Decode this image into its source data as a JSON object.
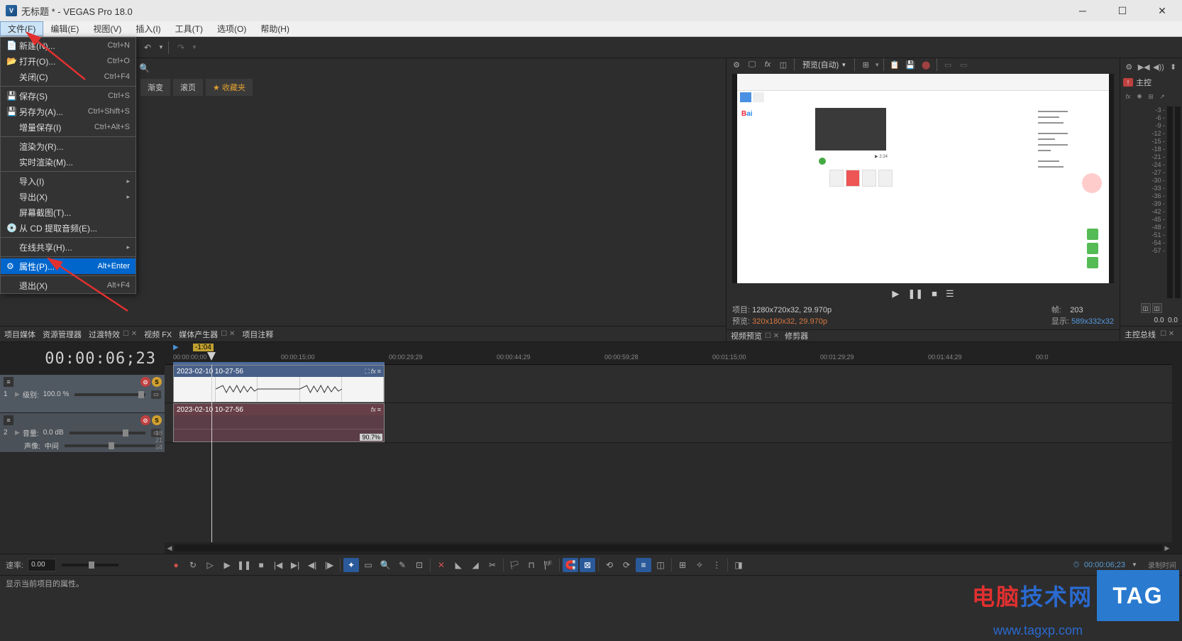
{
  "titlebar": {
    "title": "无标题 * - VEGAS Pro 18.0",
    "icon": "V"
  },
  "menubar": {
    "items": [
      "文件(F)",
      "编辑(E)",
      "视图(V)",
      "插入(I)",
      "工具(T)",
      "选项(O)",
      "帮助(H)"
    ]
  },
  "dropdown": {
    "items": [
      {
        "label": "新建(N)...",
        "shortcut": "Ctrl+N",
        "icon": "📄"
      },
      {
        "label": "打开(O)...",
        "shortcut": "Ctrl+O",
        "icon": "📂"
      },
      {
        "label": "关闭(C)",
        "shortcut": "Ctrl+F4",
        "icon": ""
      },
      {
        "sep": true
      },
      {
        "label": "保存(S)",
        "shortcut": "Ctrl+S",
        "icon": "💾"
      },
      {
        "label": "另存为(A)...",
        "shortcut": "Ctrl+Shift+S",
        "icon": "💾"
      },
      {
        "label": "增量保存(I)",
        "shortcut": "Ctrl+Alt+S",
        "icon": ""
      },
      {
        "sep": true
      },
      {
        "label": "渲染为(R)...",
        "shortcut": "",
        "icon": ""
      },
      {
        "label": "实时渲染(M)...",
        "shortcut": "",
        "icon": ""
      },
      {
        "sep": true
      },
      {
        "label": "导入(I)",
        "shortcut": "",
        "icon": "",
        "arrow": true
      },
      {
        "label": "导出(X)",
        "shortcut": "",
        "icon": "",
        "arrow": true
      },
      {
        "label": "屏幕截图(T)...",
        "shortcut": "",
        "icon": ""
      },
      {
        "label": "从 CD 提取音频(E)...",
        "shortcut": "",
        "icon": "💿"
      },
      {
        "sep": true
      },
      {
        "label": "在线共享(H)...",
        "shortcut": "",
        "icon": "",
        "arrow": true
      },
      {
        "sep": true
      },
      {
        "label": "属性(P)...",
        "shortcut": "Alt+Enter",
        "icon": "⚙",
        "highlight": true
      },
      {
        "sep": true
      },
      {
        "label": "退出(X)",
        "shortcut": "Alt+F4",
        "icon": ""
      }
    ]
  },
  "left_tabs": {
    "items": [
      {
        "label": "项目媒体"
      },
      {
        "label": "资源管理器"
      },
      {
        "label": "过渡特效",
        "close": true
      },
      {
        "label": "视频 FX"
      },
      {
        "label": "媒体产生器",
        "close": true
      },
      {
        "label": "项目注释"
      }
    ]
  },
  "sub_tabs": {
    "items": [
      "渐变",
      "滚页",
      "收藏夹"
    ]
  },
  "preview": {
    "quality": "预览(自动)",
    "transport": {
      "play": "▶",
      "pause": "❚❚",
      "stop": "■",
      "menu": "☰"
    },
    "info": {
      "project_label": "项目:",
      "project_value": "1280x720x32, 29.970p",
      "preview_label": "预览:",
      "preview_value": "320x180x32, 29.970p",
      "frame_label": "帧:",
      "frame_value": "203",
      "display_label": "显示:",
      "display_value": "589x332x32"
    },
    "tabs": [
      {
        "label": "视频预览",
        "close": true
      },
      {
        "label": "修剪器"
      }
    ]
  },
  "master": {
    "title": "主控",
    "scale": [
      "-3",
      "-6",
      "-9",
      "-12",
      "-15",
      "-18",
      "-21",
      "-24",
      "-27",
      "-30",
      "-33",
      "-36",
      "-39",
      "-42",
      "-45",
      "-48",
      "-51",
      "-54",
      "-57"
    ],
    "value": "0.0",
    "bottom": "主控总线"
  },
  "timeline": {
    "timecode": "00:00:06;23",
    "marker": "-1:04",
    "ruler": [
      "00:00:00;00",
      "00:00:15;00",
      "00:00:29;29",
      "00:00:44;29",
      "00:00:59;28",
      "00:01:15;00",
      "00:01:29;29",
      "00:01:44;29",
      "00:0"
    ],
    "tracks": [
      {
        "type": "video",
        "num": "1",
        "label": "级别:",
        "value": "100.0 %",
        "clip_name": "2023-02-10 10-27-56"
      },
      {
        "type": "audio",
        "num": "2",
        "vol_label": "音量:",
        "vol_value": "0.0 dB",
        "pan_label": "声像:",
        "pan_value": "中间",
        "scale": [
          "18",
          "21",
          "54"
        ],
        "clip_name": "2023-02-10 10-27-56",
        "clip_pct": "90.7%"
      }
    ]
  },
  "transport": {
    "rate_label": "速率:",
    "rate_value": "0.00",
    "timecode": "00:00:06;23",
    "status": "录制时间"
  },
  "statusbar": {
    "left": "显示当前项目的属性。"
  },
  "watermark": {
    "text1": "电脑",
    "text2": "技术网",
    "tag": "TAG",
    "url": "www.tagxp.com"
  }
}
